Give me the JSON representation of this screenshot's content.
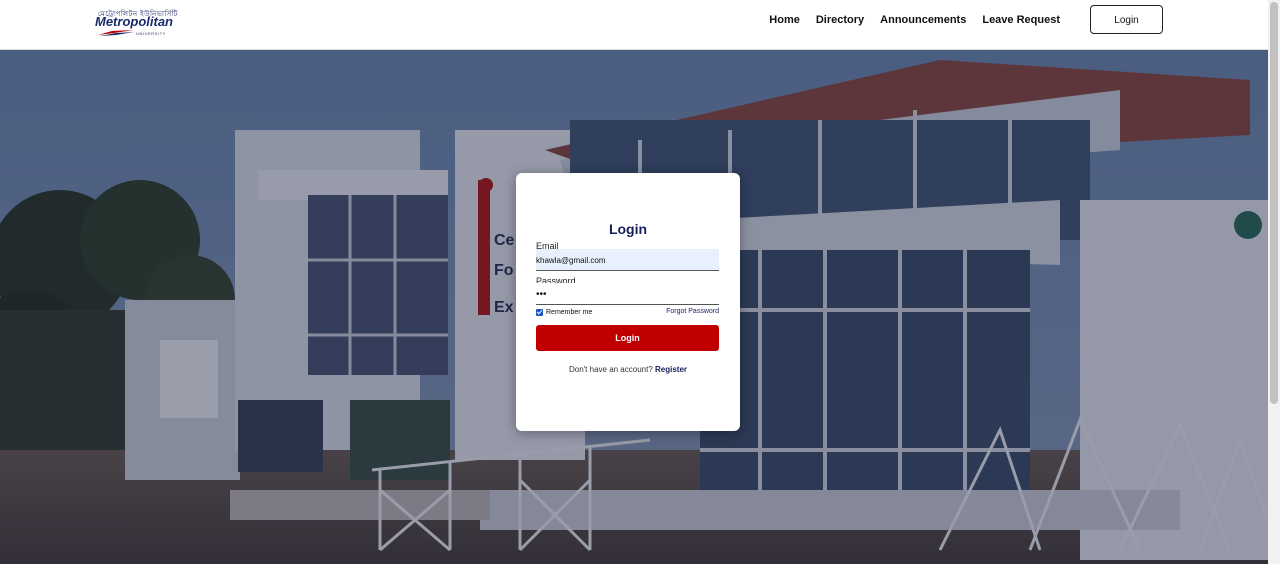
{
  "logo": {
    "top_text": "মেট্রোপলিটন ইউনিভার্সিটি",
    "main_text": "Metropolitan",
    "sub_text": "UNIVERSITY"
  },
  "nav": {
    "items": [
      {
        "label": "Home"
      },
      {
        "label": "Directory"
      },
      {
        "label": "Announcements"
      },
      {
        "label": "Leave Request"
      }
    ],
    "login_label": "Login"
  },
  "login_form": {
    "title": "Login",
    "email_label": "Email",
    "email_value": "khawla@gmail.com",
    "password_label": "Password",
    "password_value": "•••",
    "remember_label": "Remember me",
    "remember_checked": true,
    "forgot_label": "Forgot Password",
    "submit_label": "Login",
    "register_prompt": "Don't have an account?",
    "register_link": "Register"
  },
  "colors": {
    "brand_navy": "#1a1f5c",
    "accent_red": "#c00000",
    "checkbox_blue": "#1a56c4",
    "autofill_bg": "#e8f0fe"
  }
}
